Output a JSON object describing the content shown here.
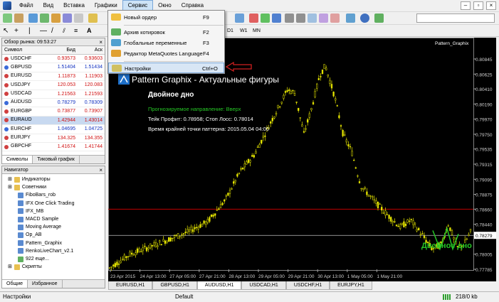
{
  "menubar": {
    "items": [
      "Файл",
      "Вид",
      "Вставка",
      "Графики",
      "Сервис",
      "Окно",
      "Справка"
    ],
    "active_index": 4
  },
  "dropdown": {
    "items": [
      {
        "label": "Новый ордер",
        "shortcut": "F9",
        "icon": "new-order-icon"
      },
      {
        "label": "Архив котировок",
        "shortcut": "F2",
        "icon": "history-center-icon"
      },
      {
        "label": "Глобальные переменные",
        "shortcut": "F3",
        "icon": "global-variables-icon"
      },
      {
        "label": "Редактор MetaQuotes Language",
        "shortcut": "F4",
        "icon": "metaeditor-icon"
      },
      {
        "label": "Настройки",
        "shortcut": "Ctrl+O",
        "icon": "options-icon"
      }
    ],
    "highlighted_index": 4
  },
  "toolbar": {
    "timeframes": [
      "D1",
      "W1",
      "MN"
    ]
  },
  "market_watch": {
    "title": "Обзор рынка: 09:53:27",
    "columns": [
      "Символ",
      "Бид",
      "Аск"
    ],
    "rows": [
      {
        "symbol": "USDCHF",
        "bid": "0.93573",
        "ask": "0.93603",
        "bid_color": "red",
        "ask_color": "red"
      },
      {
        "symbol": "GBPUSD",
        "bid": "1.51404",
        "ask": "1.51434",
        "bid_color": "blue",
        "ask_color": "blue"
      },
      {
        "symbol": "EURUSD",
        "bid": "1.11873",
        "ask": "1.11903",
        "bid_color": "red",
        "ask_color": "red"
      },
      {
        "symbol": "USDJPY",
        "bid": "120.053",
        "ask": "120.083",
        "bid_color": "red",
        "ask_color": "red"
      },
      {
        "symbol": "USDCAD",
        "bid": "1.21563",
        "ask": "1.21593",
        "bid_color": "red",
        "ask_color": "red"
      },
      {
        "symbol": "AUDUSD",
        "bid": "0.78279",
        "ask": "0.78309",
        "bid_color": "blue",
        "ask_color": "blue"
      },
      {
        "symbol": "EURGBP",
        "bid": "0.73877",
        "ask": "0.73907",
        "bid_color": "red",
        "ask_color": "red"
      },
      {
        "symbol": "EURAUD",
        "bid": "1.42944",
        "ask": "1.43014",
        "bid_color": "red",
        "ask_color": "red"
      },
      {
        "symbol": "EURCHF",
        "bid": "1.04695",
        "ask": "1.04725",
        "bid_color": "blue",
        "ask_color": "blue"
      },
      {
        "symbol": "EURJPY",
        "bid": "134.325",
        "ask": "134.355",
        "bid_color": "red",
        "ask_color": "red"
      },
      {
        "symbol": "GBPCHF",
        "bid": "1.41674",
        "ask": "1.41744",
        "bid_color": "red",
        "ask_color": "red"
      }
    ],
    "selected_index": 7,
    "tabs": [
      "Символы",
      "Тиковый график"
    ]
  },
  "navigator": {
    "title": "Навигатор",
    "items": [
      {
        "label": "Индикаторы",
        "level": 1,
        "icon": "folder-icon"
      },
      {
        "label": "Советники",
        "level": 1,
        "icon": "folder-icon"
      },
      {
        "label": "FiboBars_rob",
        "level": 2,
        "icon": "expert-icon"
      },
      {
        "label": "IFX One Click Trading",
        "level": 2,
        "icon": "expert-icon"
      },
      {
        "label": "IFX_MB",
        "level": 2,
        "icon": "expert-icon"
      },
      {
        "label": "MACD Sample",
        "level": 2,
        "icon": "expert-icon"
      },
      {
        "label": "Moving Average",
        "level": 2,
        "icon": "expert-icon"
      },
      {
        "label": "Op_AB",
        "level": 2,
        "icon": "expert-icon"
      },
      {
        "label": "Pattern_Graphix",
        "level": 2,
        "icon": "expert-icon"
      },
      {
        "label": "RenkoLiveChart_v2.1",
        "level": 2,
        "icon": "expert-icon"
      },
      {
        "label": "922 еще...",
        "level": 2,
        "icon": "more-icon"
      },
      {
        "label": "Скрипты",
        "level": 1,
        "icon": "folder-icon"
      }
    ],
    "tabs": [
      "Общие",
      "Избранное"
    ]
  },
  "chart": {
    "indicator_label": "Pattern_Graphix",
    "title": "Pattern Graphix - Актуальные фигуры",
    "pattern_name": "Двойное дно",
    "forecast": "Прогнозируемое направление: Вверх",
    "tp_sl": "Тейк Профит: 0.78958; Стоп Лосс: 0.78014",
    "time_point": "Время крайней точки паттерна: 2015.05.04 04:00",
    "pattern_label": "Двойное дно",
    "price_labels": [
      "0.80845",
      "0.80625",
      "0.80410",
      "0.80190",
      "0.79970",
      "0.79750",
      "0.79535",
      "0.79315",
      "0.79095",
      "0.78875",
      "0.78660",
      "0.78440",
      "0.78279",
      "0.78005",
      "0.77785"
    ],
    "red_line_price": "0.78660",
    "current_price": "0.78279",
    "time_labels": [
      "23 Apr 2015",
      "24 Apr 13:00",
      "27 Apr 05:00",
      "27 Apr 21:00",
      "28 Apr 13:00",
      "29 Apr 05:00",
      "29 Apr 21:00",
      "30 Apr 13:00",
      "1 May 05:00",
      "1 May 21:00"
    ],
    "colors": {
      "candles": "#e6e600",
      "red_line": "#c00000",
      "green_text": "#26c626",
      "pattern": "#26c626"
    }
  },
  "chart_tabs": [
    "EURUSD,H1",
    "GBPUSD,H1",
    "AUDUSD,H1",
    "USDCAD,H1",
    "USDCHF,H1",
    "EURJPY,H1"
  ],
  "chart_tabs_active": 2,
  "statusbar": {
    "left": "Настройки",
    "middle": "Default",
    "right": "218/0 kb"
  }
}
